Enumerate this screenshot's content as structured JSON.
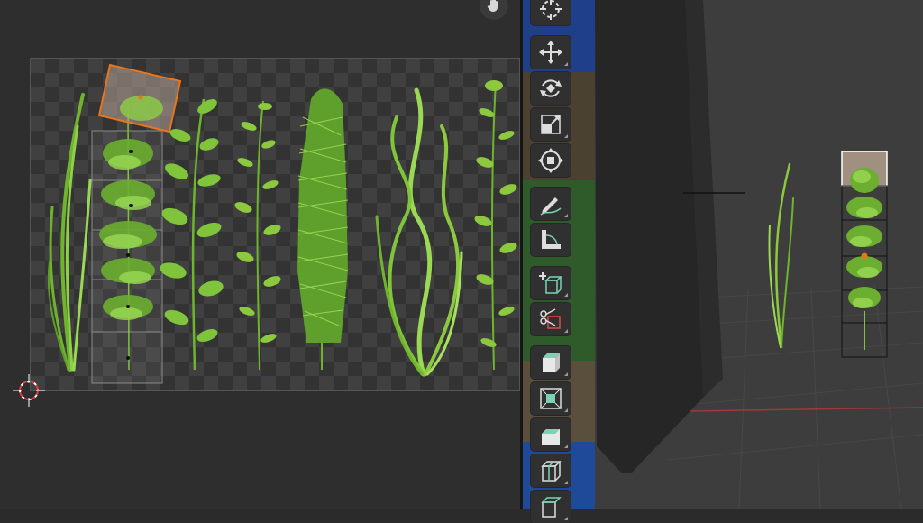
{
  "uv_editor": {
    "plants": [
      "grass-blade",
      "bushy-plant-selected",
      "leafy-stem",
      "small-leaf-stem",
      "horsetail-plant",
      "wavy-grass",
      "leafy-stem-right"
    ]
  },
  "viewport": {
    "objects": [
      "tall-grass",
      "plant-card-selected",
      "dark-wall-panel"
    ]
  },
  "toolbar": {
    "tools": [
      {
        "name": "cursor-tool",
        "icon": "crosshair-cursor-icon"
      },
      {
        "name": "move-tool",
        "icon": "move-arrows-icon"
      },
      {
        "name": "rotate-tool",
        "icon": "rotate-icon"
      },
      {
        "name": "scale-tool",
        "icon": "scale-icon"
      },
      {
        "name": "transform-tool",
        "icon": "transform-icon"
      },
      {
        "name": "annotate-tool",
        "icon": "pencil-icon"
      },
      {
        "name": "measure-tool",
        "icon": "ruler-icon"
      },
      {
        "name": "add-cube-tool",
        "icon": "add-cube-icon"
      },
      {
        "name": "knife-tool",
        "icon": "knife-icon"
      },
      {
        "name": "extrude-tool",
        "icon": "extrude-icon"
      },
      {
        "name": "inset-tool",
        "icon": "inset-icon"
      },
      {
        "name": "bevel-tool",
        "icon": "bevel-icon"
      },
      {
        "name": "loop-cut-tool",
        "icon": "loop-cut-icon"
      },
      {
        "name": "poly-build-tool",
        "icon": "poly-build-icon"
      }
    ]
  },
  "colors": {
    "background": "#2b2b2b",
    "selection_orange": "#e8761d",
    "plant_green": "#7fc43a",
    "tool_accent": "#7ad3b2"
  }
}
